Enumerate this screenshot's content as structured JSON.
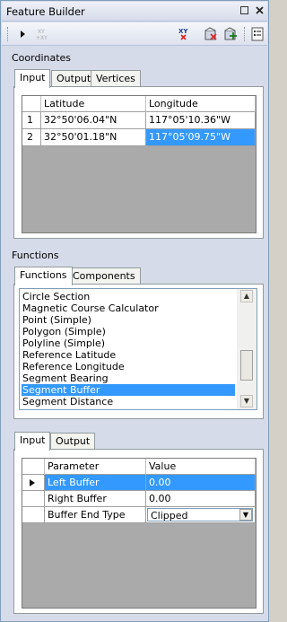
{
  "window": {
    "title": "Feature Builder",
    "pin_icon": "▫",
    "close_icon": "✕"
  },
  "toolbar": {
    "items": [
      "play-icon",
      "xy-disabled-icon",
      "xy-remove-icon",
      "delete-features-icon",
      "add-features-icon",
      "properties-icon"
    ]
  },
  "coordinates": {
    "label": "Coordinates",
    "tabs": [
      "Input",
      "Output",
      "Vertices"
    ],
    "active_tab": "Input",
    "columns": [
      "Latitude",
      "Longitude"
    ],
    "rows": [
      {
        "num": "1",
        "lat": "32°50'06.04\"N",
        "lon": "117°05'10.36\"W"
      },
      {
        "num": "2",
        "lat": "32°50'01.18\"N",
        "lon": "117°05'09.75\"W"
      }
    ],
    "selected_cell": "row 2 longitude"
  },
  "functions": {
    "label": "Functions",
    "tabs": [
      "Functions",
      "Components"
    ],
    "active_tab": "Functions",
    "items": [
      "Circle Section",
      "Magnetic Course Calculator",
      "Point (Simple)",
      "Polygon (Simple)",
      "Polyline (Simple)",
      "Reference Latitude",
      "Reference Longitude",
      "Segment Bearing",
      "Segment Buffer",
      "Segment Distance"
    ],
    "selected": "Segment Buffer"
  },
  "parameters": {
    "tabs": [
      "Input",
      "Output"
    ],
    "active_tab": "Input",
    "columns": [
      "Parameter",
      "Value"
    ],
    "rows": [
      {
        "param": "Left Buffer",
        "value": "0.00"
      },
      {
        "param": "Right Buffer",
        "value": "0.00"
      },
      {
        "param": "Buffer End Type",
        "value": "Clipped"
      }
    ],
    "selected_row": "Left Buffer"
  }
}
